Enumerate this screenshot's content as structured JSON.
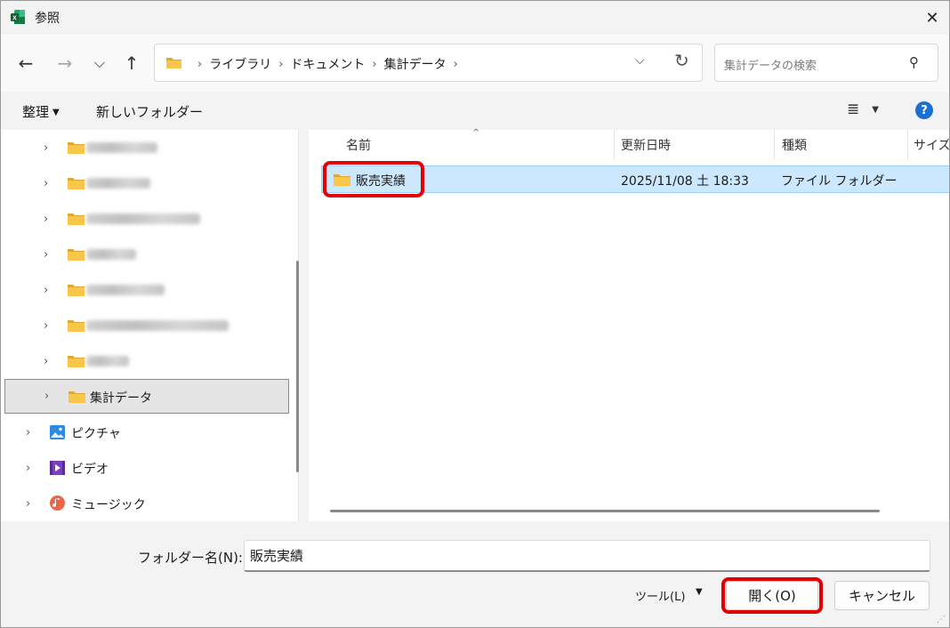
{
  "window": {
    "title": "参照",
    "close_glyph": "✕"
  },
  "icons": {
    "app": "excel-icon",
    "folder_color": "#f7c64a",
    "folder_dark": "#e0a82e"
  },
  "nav_buttons": {
    "back": "←",
    "forward": "→",
    "recent": "⌵",
    "up": "↑"
  },
  "address": {
    "crumbs": [
      "ライブラリ",
      "ドキュメント",
      "集計データ"
    ],
    "separator": "›"
  },
  "search": {
    "placeholder": "集計データの検索"
  },
  "commands": {
    "organize": "整理",
    "new_folder": "新しいフォルダー",
    "help": "?"
  },
  "nav_pane": {
    "items": [
      {
        "label": "",
        "blurred": true
      },
      {
        "label": "",
        "blurred": true
      },
      {
        "label": "",
        "blurred": true
      },
      {
        "label": "",
        "blurred": true
      },
      {
        "label": "",
        "blurred": true
      },
      {
        "label": "",
        "blurred": true
      },
      {
        "label": "",
        "blurred": true
      },
      {
        "label": "集計データ",
        "selected": true
      },
      {
        "label": "ピクチャ",
        "icon": "pictures-icon"
      },
      {
        "label": "ビデオ",
        "icon": "videos-icon"
      },
      {
        "label": "ミュージック",
        "icon": "music-icon"
      }
    ]
  },
  "columns": [
    "名前",
    "更新日時",
    "種類",
    "サイズ"
  ],
  "files": [
    {
      "name": "販売実績",
      "modified": "2025/11/08 土 18:33",
      "type": "ファイル フォルダー"
    }
  ],
  "footer": {
    "folder_label": "フォルダー名(N):",
    "folder_value": "販売実績",
    "tools": "ツール(L)",
    "open": "開く(O)",
    "cancel": "キャンセル"
  },
  "highlight_color": "#e30000"
}
